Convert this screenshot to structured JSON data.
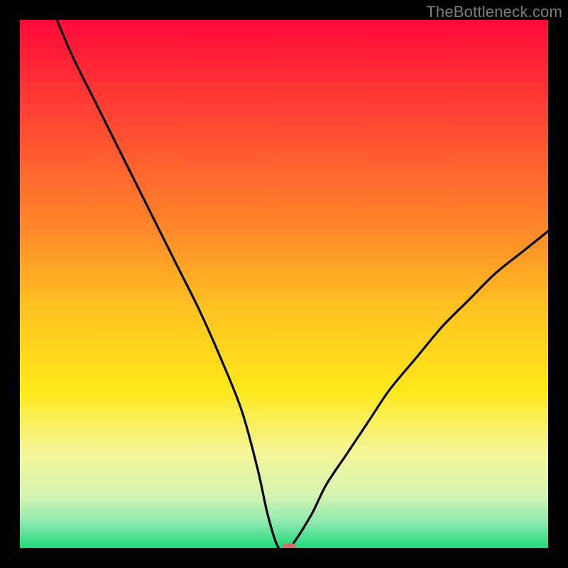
{
  "watermark": "TheBottleneck.com",
  "chart_data": {
    "type": "line",
    "title": "",
    "xlabel": "",
    "ylabel": "",
    "xlim": [
      0,
      100
    ],
    "ylim": [
      0,
      100
    ],
    "grid": false,
    "x": [
      7,
      10,
      14,
      18,
      22,
      26,
      30,
      34,
      38,
      42,
      45,
      47,
      49,
      51,
      55,
      58,
      62,
      66,
      70,
      75,
      80,
      85,
      90,
      95,
      100
    ],
    "values": [
      100,
      93,
      85,
      77,
      69,
      61,
      53,
      45,
      36,
      26,
      15,
      6,
      0,
      0,
      6,
      12,
      18,
      24,
      30,
      36,
      42,
      47,
      52,
      56,
      60
    ],
    "series_name": "bottleneck_percent",
    "marker": {
      "x": 51,
      "y": 0,
      "color": "#d86a6a"
    },
    "background_gradient": {
      "stops": [
        {
          "offset": 0.0,
          "color": "#ff0a3a"
        },
        {
          "offset": 0.2,
          "color": "#ff4a32"
        },
        {
          "offset": 0.4,
          "color": "#ff8a2a"
        },
        {
          "offset": 0.55,
          "color": "#ffc420"
        },
        {
          "offset": 0.7,
          "color": "#ffe81a"
        },
        {
          "offset": 0.82,
          "color": "#f5f69a"
        },
        {
          "offset": 0.9,
          "color": "#d5f4b0"
        },
        {
          "offset": 0.95,
          "color": "#8ee9b0"
        },
        {
          "offset": 1.0,
          "color": "#1ed97a"
        }
      ]
    }
  }
}
